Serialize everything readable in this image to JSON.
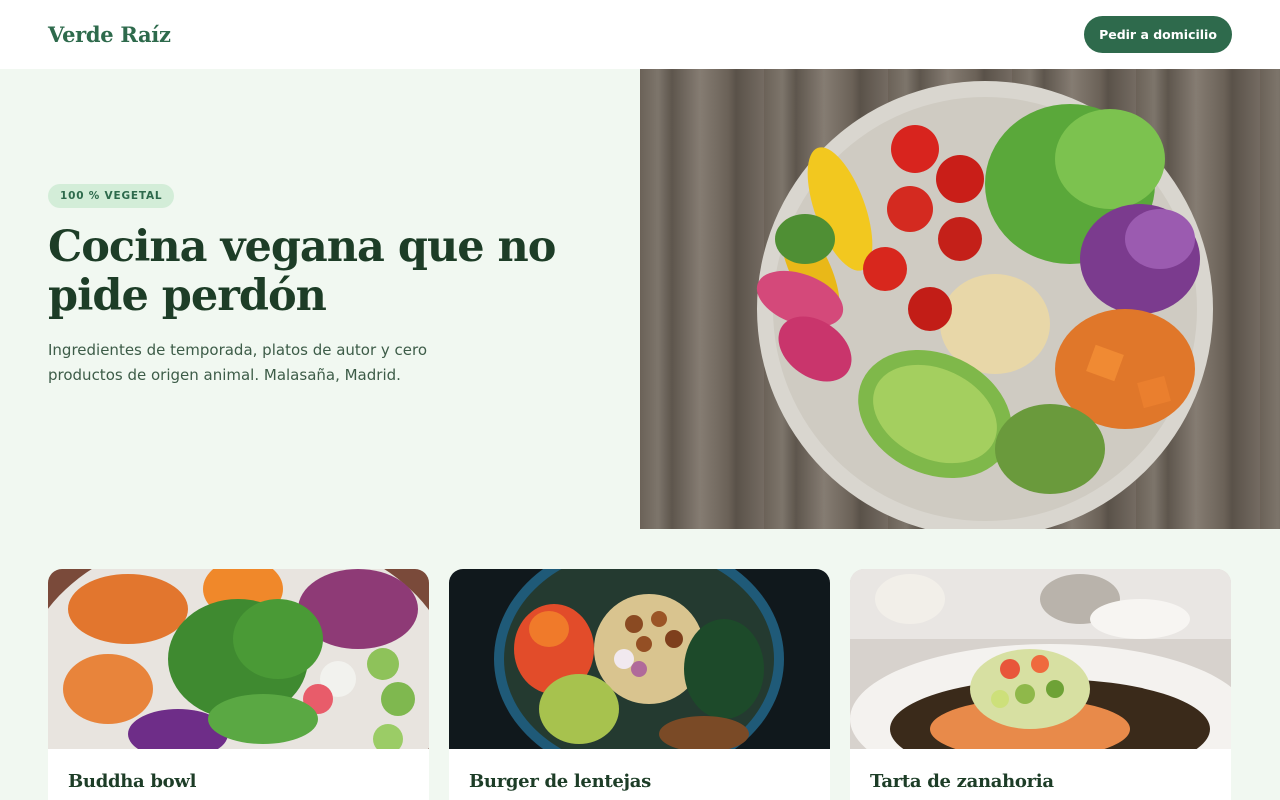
{
  "header": {
    "logo": "Verde Raíz",
    "cta_label": "Pedir a domicilio"
  },
  "hero": {
    "badge": "100 % VEGETAL",
    "headline_line1": "Cocina vegana que no",
    "headline_line2": "pide perdón",
    "lead_line1": "Ingredientes de temporada, platos de autor y cero",
    "lead_line2": "productos de origen animal. Malasaña, Madrid.",
    "image": "vegetable-bowl-photo"
  },
  "dishes": [
    {
      "title": "Buddha bowl",
      "image": "salad-bowl-photo"
    },
    {
      "title": "Burger de lentejas",
      "image": "chickpea-bowl-photo"
    },
    {
      "title": "Tarta de zanahoria",
      "image": "plated-dish-photo"
    }
  ],
  "colors": {
    "brand_green": "#2e6a4c",
    "page_background": "#f1f8f1",
    "badge_background": "#d3edd8",
    "heading": "#1d3d27"
  }
}
